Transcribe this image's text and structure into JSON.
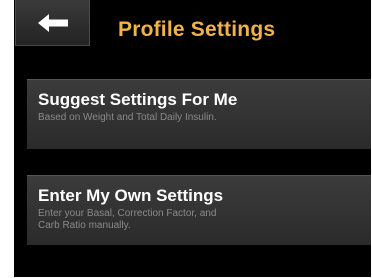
{
  "header": {
    "title": "Profile Settings",
    "back_icon": "left-arrow-icon"
  },
  "options": [
    {
      "title": "Suggest Settings For Me",
      "description": "Based on Weight and Total Daily Insulin."
    },
    {
      "title": "Enter My Own Settings",
      "description": "Enter your Basal, Correction Factor, and\nCarb Ratio manually."
    }
  ],
  "colors": {
    "title_accent": "#f2b24a",
    "background": "#000000",
    "option_background": "#333333",
    "option_text": "#ffffff",
    "description_text": "#8a8a8a"
  }
}
